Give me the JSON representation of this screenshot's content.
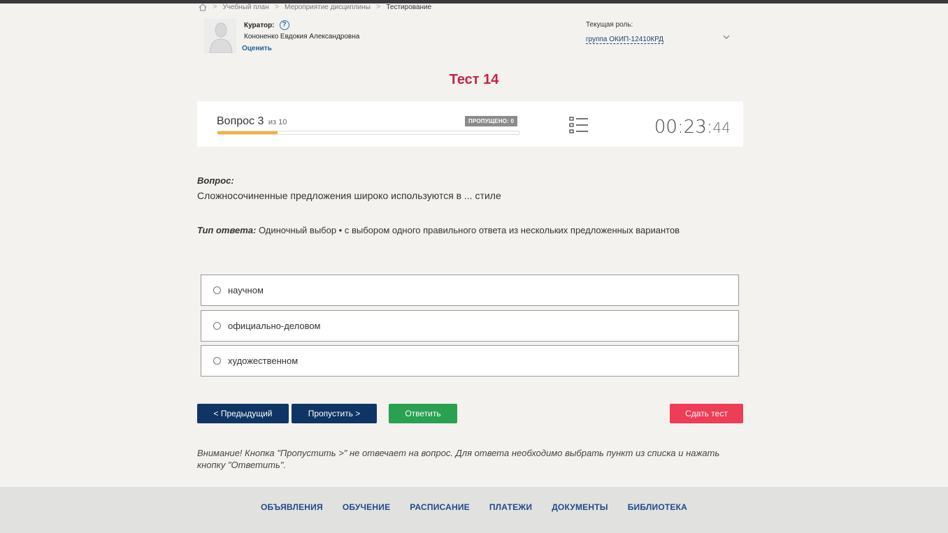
{
  "breadcrumb": {
    "home_icon": "home-icon",
    "items": [
      "Учебный план",
      "Мероприятие дисциплины",
      "Тестирование"
    ]
  },
  "curator": {
    "label": "Куратор:",
    "help_icon": "question-circle-icon",
    "name": "Кононенко Евдокия Александровна",
    "rate_link": "Оценить"
  },
  "role": {
    "label": "Текущая роль:",
    "value": "группа ОКИП-12410КРД"
  },
  "test": {
    "title": "Тест 14"
  },
  "status": {
    "question_word": "Вопрос",
    "current": "3",
    "of_text": "из 10",
    "progress_fraction": 0.2,
    "skipped_badge": "ПРОПУЩЕНО: 0",
    "timer_main": "00:23:",
    "timer_seconds": "44"
  },
  "question": {
    "label": "Вопрос:",
    "text": "Сложносочиненные предложения широко используются в ... стиле",
    "answer_type_label": "Тип ответа:",
    "answer_type_text": " Одиночный выбор • с выбором одного правильного ответа из нескольких предложенных вариантов",
    "options": [
      "научном",
      "официально-деловом",
      "художественном"
    ]
  },
  "buttons": {
    "prev": "< Предыдущий",
    "skip": "Пропустить >",
    "answer": "Ответить",
    "submit": "Сдать тест"
  },
  "warning": "Внимание! Кнопка \"Пропустить >\" не отвечает на вопрос. Для ответа необходимо выбрать пункт из списка и нажать кнопку \"Ответить\".",
  "footer": {
    "nav": [
      "ОБЪЯВЛЕНИЯ",
      "ОБУЧЕНИЕ",
      "РАСПИСАНИЕ",
      "ПЛАТЕЖИ",
      "ДОКУМЕНТЫ",
      "БИБЛИОТЕКА"
    ]
  },
  "colors": {
    "title": "#c8214a",
    "primary_button": "#0f3564",
    "answer_button": "#2aa051",
    "submit_button": "#ef3c57",
    "progress": "#f0b33b"
  }
}
